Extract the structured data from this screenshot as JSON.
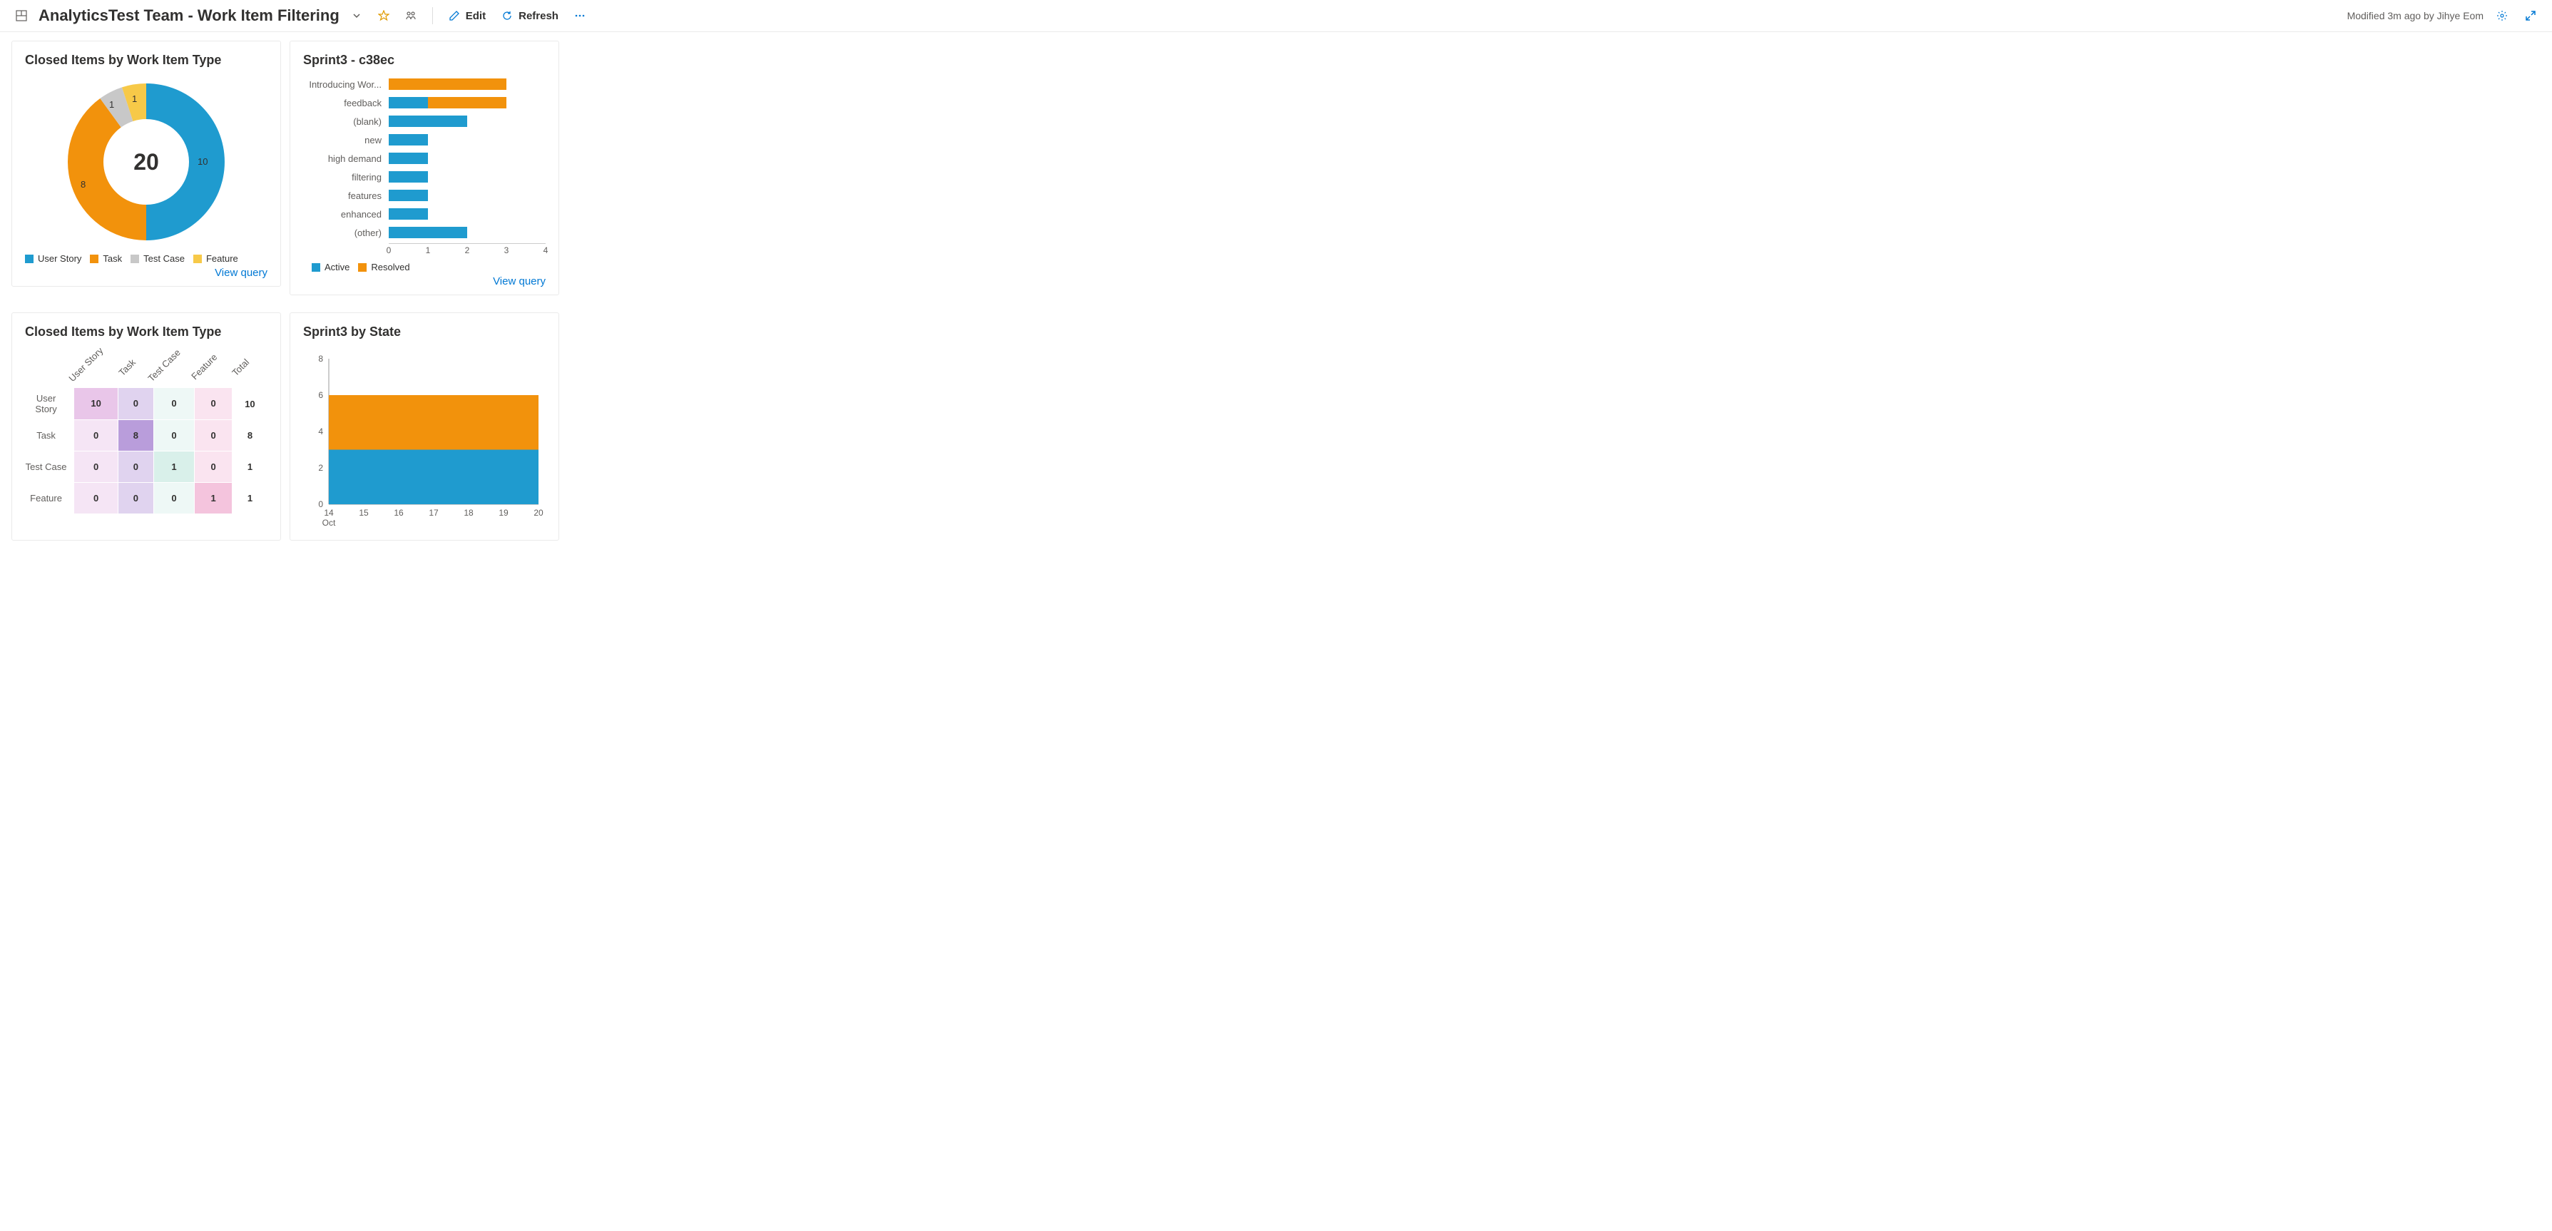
{
  "header": {
    "title": "AnalyticsTest Team - Work Item Filtering",
    "edit_label": "Edit",
    "refresh_label": "Refresh",
    "modified_text": "Modified 3m ago by Jihye Eom"
  },
  "colors": {
    "blue": "#1f9bcf",
    "orange": "#f2920c",
    "gray": "#c8c8c8",
    "yellow": "#f7c948",
    "link": "#0078d4"
  },
  "widgets": {
    "donut": {
      "title": "Closed Items by Work Item Type",
      "view_query_label": "View query",
      "center_total": "20",
      "legend": [
        {
          "label": "User Story",
          "color": "#1f9bcf"
        },
        {
          "label": "Task",
          "color": "#f2920c"
        },
        {
          "label": "Test Case",
          "color": "#c8c8c8"
        },
        {
          "label": "Feature",
          "color": "#f7c948"
        }
      ],
      "slice_labels": {
        "user_story": "10",
        "task": "8",
        "test_case": "1",
        "feature": "1"
      }
    },
    "hbar": {
      "title": "Sprint3 - c38ec",
      "view_query_label": "View query",
      "legend": [
        {
          "label": "Active",
          "color": "#1f9bcf"
        },
        {
          "label": "Resolved",
          "color": "#f2920c"
        }
      ],
      "xticks": [
        "0",
        "1",
        "2",
        "3",
        "4"
      ]
    },
    "heat": {
      "title": "Closed Items by Work Item Type"
    },
    "area": {
      "title": "Sprint3 by State"
    }
  },
  "chart_data": [
    {
      "id": "donut",
      "type": "pie",
      "title": "Closed Items by Work Item Type",
      "categories": [
        "User Story",
        "Task",
        "Test Case",
        "Feature"
      ],
      "values": [
        10,
        8,
        1,
        1
      ],
      "total": 20
    },
    {
      "id": "hbar",
      "type": "bar",
      "orientation": "horizontal",
      "title": "Sprint3 - c38ec",
      "categories": [
        "Introducing Wor...",
        "feedback",
        "(blank)",
        "new",
        "high demand",
        "filtering",
        "features",
        "enhanced",
        "(other)"
      ],
      "series": [
        {
          "name": "Active",
          "values": [
            0,
            1,
            2,
            1,
            1,
            1,
            1,
            1,
            2
          ]
        },
        {
          "name": "Resolved",
          "values": [
            3,
            2,
            0,
            0,
            0,
            0,
            0,
            0,
            0
          ]
        }
      ],
      "xlim": [
        0,
        4
      ],
      "xlabel": "",
      "ylabel": ""
    },
    {
      "id": "heat",
      "type": "heatmap",
      "title": "Closed Items by Work Item Type",
      "row_labels": [
        "User Story",
        "Task",
        "Test Case",
        "Feature"
      ],
      "col_labels": [
        "User Story",
        "Task",
        "Test Case",
        "Feature",
        "Total"
      ],
      "cells": [
        [
          10,
          0,
          0,
          0,
          10
        ],
        [
          0,
          8,
          0,
          0,
          8
        ],
        [
          0,
          0,
          1,
          0,
          1
        ],
        [
          0,
          0,
          0,
          1,
          1
        ]
      ],
      "col_colors": [
        "#e9c6e9",
        "#b99ddb",
        "#d9f0ea",
        "#f4c4dd",
        null
      ]
    },
    {
      "id": "area",
      "type": "area",
      "title": "Sprint3 by State",
      "x": [
        14,
        15,
        16,
        17,
        18,
        19,
        20
      ],
      "x_sublabel": "Oct",
      "series": [
        {
          "name": "Active",
          "color": "#1f9bcf",
          "values": [
            3,
            3,
            3,
            3,
            3,
            3,
            3
          ]
        },
        {
          "name": "Resolved",
          "color": "#f2920c",
          "values": [
            3,
            3,
            3,
            3,
            3,
            3,
            3
          ]
        }
      ],
      "ylim": [
        0,
        8
      ],
      "yticks": [
        0,
        2,
        4,
        6,
        8
      ]
    }
  ]
}
